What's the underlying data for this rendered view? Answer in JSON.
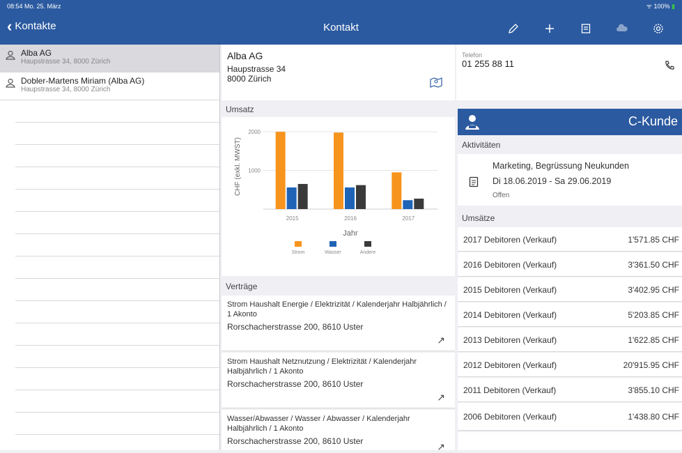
{
  "status": {
    "time_date": "08:54  Mo. 25. März",
    "battery": "100%"
  },
  "navbar": {
    "back_label": "Kontakte",
    "title": "Kontakt"
  },
  "contacts": [
    {
      "name": "Alba AG",
      "address": "Haupstrasse 34, 8000 Zürich"
    },
    {
      "name": "Dobler-Martens Miriam (Alba AG)",
      "address": "Haupstrasse 34, 8000 Zürich"
    }
  ],
  "address_card": {
    "name": "Alba AG",
    "street": "Haupstrasse 34",
    "city": "8000 Zürich"
  },
  "phone": {
    "label": "Telefon",
    "number": "01 255 88 11"
  },
  "umsatz_header": "Umsatz",
  "chart_data": {
    "type": "bar",
    "categories": [
      "2015",
      "2016",
      "2017"
    ],
    "series": [
      {
        "name": "Strom",
        "values": [
          2000,
          1980,
          950
        ],
        "color": "#f7941d"
      },
      {
        "name": "Wasser",
        "values": [
          560,
          560,
          230
        ],
        "color": "#1f63b7"
      },
      {
        "name": "Andere",
        "values": [
          650,
          620,
          270
        ],
        "color": "#3a3a3a"
      }
    ],
    "xlabel": "Jahr",
    "ylabel": "CHF (exkl. MWST)",
    "yticks": [
      2000,
      1000
    ],
    "ylim": [
      0,
      2200
    ],
    "legend": "bottom"
  },
  "vertraege_header": "Verträge",
  "vertraege": [
    {
      "desc": "Strom Haushalt Energie / Elektrizität / Kalenderjahr Halbjährlich / 1 Akonto",
      "address": "Rorschacherstrasse 200, 8610 Uster"
    },
    {
      "desc": "Strom Haushalt Netznutzung / Elektrizität / Kalenderjahr Halbjährlich / 1 Akonto",
      "address": "Rorschacherstrasse 200, 8610 Uster"
    },
    {
      "desc": "Wasser/Abwasser / Wasser / Abwasser / Kalenderjahr Halbjährlich / 1 Akonto",
      "address": "Rorschacherstrasse 200, 8610 Uster"
    }
  ],
  "kunde_label": "C-Kunde",
  "aktivitaeten_header": "Aktivitäten",
  "aktivitaet": {
    "title": "Marketing, Begrüssung Neukunden",
    "date": "Di 18.06.2019 - Sa 29.06.2019",
    "state": "Offen"
  },
  "umsaetze_header": "Umsätze",
  "umsaetze": [
    {
      "label": "2017 Debitoren (Verkauf)",
      "amount": "1'571.85 CHF"
    },
    {
      "label": "2016 Debitoren (Verkauf)",
      "amount": "3'361.50 CHF"
    },
    {
      "label": "2015 Debitoren (Verkauf)",
      "amount": "3'402.95 CHF"
    },
    {
      "label": "2014 Debitoren (Verkauf)",
      "amount": "5'203.85 CHF"
    },
    {
      "label": "2013 Debitoren (Verkauf)",
      "amount": "1'622.85 CHF"
    },
    {
      "label": "2012 Debitoren (Verkauf)",
      "amount": "20'915.95 CHF"
    },
    {
      "label": "2011 Debitoren (Verkauf)",
      "amount": "3'855.10 CHF"
    },
    {
      "label": "2006 Debitoren (Verkauf)",
      "amount": "1'438.80 CHF"
    }
  ],
  "icons": [
    "pencil-icon",
    "plus-icon",
    "save-icon",
    "cloud-icon",
    "settings-icon",
    "map-icon",
    "phone-icon",
    "user-icon",
    "document-icon",
    "arrow-icon"
  ]
}
